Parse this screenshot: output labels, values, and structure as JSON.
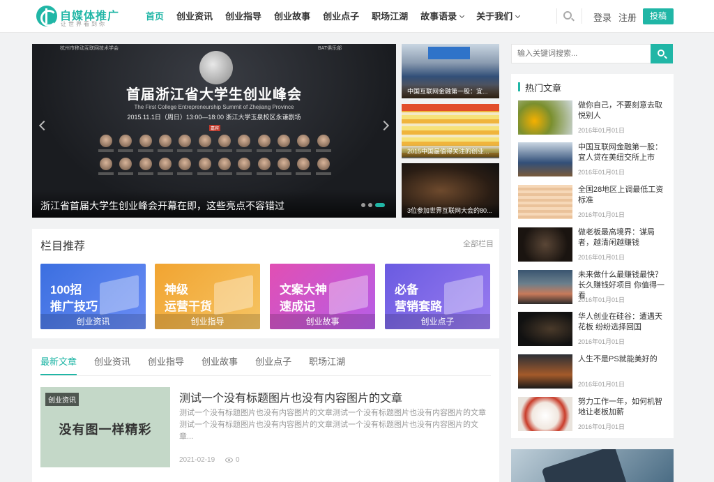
{
  "header": {
    "logo_text": "自媒体推广",
    "logo_slogan": "让世界看到你",
    "nav": [
      {
        "label": "首页",
        "active": true,
        "dropdown": false
      },
      {
        "label": "创业资讯",
        "active": false,
        "dropdown": false
      },
      {
        "label": "创业指导",
        "active": false,
        "dropdown": false
      },
      {
        "label": "创业故事",
        "active": false,
        "dropdown": false
      },
      {
        "label": "创业点子",
        "active": false,
        "dropdown": false
      },
      {
        "label": "职场江湖",
        "active": false,
        "dropdown": false
      },
      {
        "label": "故事语录",
        "active": false,
        "dropdown": true
      },
      {
        "label": "关于我们",
        "active": false,
        "dropdown": true
      }
    ],
    "login": "登录",
    "register": "注册",
    "contribute": "投稿",
    "accent_color": "#20b6a6"
  },
  "slider": {
    "title": "首届浙江省大学生创业峰会",
    "subtitle": "The First College Entrepreneurship Summit of Zhejiang Province",
    "date_line": "2015.11.1日（周日）13:00—18:00  浙江大学玉泉校区永谦剧场",
    "tag": "嘉宾",
    "top_left": "杭州市移动互联网技术学会",
    "top_right": "BAT俱乐部",
    "caption": "浙江省首届大学生创业峰会开幕在即，这些亮点不容错过",
    "dots": 3,
    "active_dot": 2
  },
  "side_posts": [
    {
      "caption": "中国互联网金融第一股：宜..."
    },
    {
      "caption": "2015中国最值得关注的创业..."
    },
    {
      "caption": "3位参加世界互联网大会的80..."
    }
  ],
  "columns": {
    "title": "栏目推荐",
    "all_link": "全部栏目",
    "tiles": [
      {
        "big_line1": "100招",
        "big_line2": "推广技巧",
        "label": "创业资讯"
      },
      {
        "big_line1": "神级",
        "big_line2": "运营干货",
        "label": "创业指导"
      },
      {
        "big_line1": "文案大神",
        "big_line2": "速成记",
        "label": "创业故事"
      },
      {
        "big_line1": "必备",
        "big_line2": "营销套路",
        "label": "创业点子"
      }
    ]
  },
  "tabs": [
    "最新文章",
    "创业资讯",
    "创业指导",
    "创业故事",
    "创业点子",
    "职场江湖"
  ],
  "article": {
    "badge": "创业资讯",
    "thumb_text": "没有图一样精彩",
    "title": "测试一个没有标题图片也没有内容图片的文章",
    "excerpt": "测试一个没有标题图片也没有内容图片的文章测试一个没有标题图片也没有内容图片的文章测试一个没有标题图片也没有内容图片的文章测试一个没有标题图片也没有内容图片的文章...",
    "date": "2021-02-19",
    "views": "0"
  },
  "sidebar": {
    "search_placeholder": "输入关键词搜索...",
    "hot_title": "热门文章",
    "hot_items": [
      {
        "title": "做你自己，不要刻意去取悦别人",
        "date": "2016年01月01日"
      },
      {
        "title": "中国互联网金融第一股：宜人贷在美纽交所上市",
        "date": "2016年01月01日"
      },
      {
        "title": "全国28地区上调最低工资标准",
        "date": "2016年01月01日"
      },
      {
        "title": "做老板最高境界：谋局者，越清闲越赚钱",
        "date": "2016年01月01日"
      },
      {
        "title": "未来做什么最赚钱最快？长久赚钱好项目 你值得一看",
        "date": "2016年01月01日"
      },
      {
        "title": "华人创业在硅谷：遭遇天花板 纷纷选择回国",
        "date": "2016年01月01日"
      },
      {
        "title": "人生不是PS就能美好的",
        "date": "2016年01月01日"
      },
      {
        "title": "努力工作一年，如何机智地让老板加薪",
        "date": "2016年01月01日"
      }
    ]
  }
}
